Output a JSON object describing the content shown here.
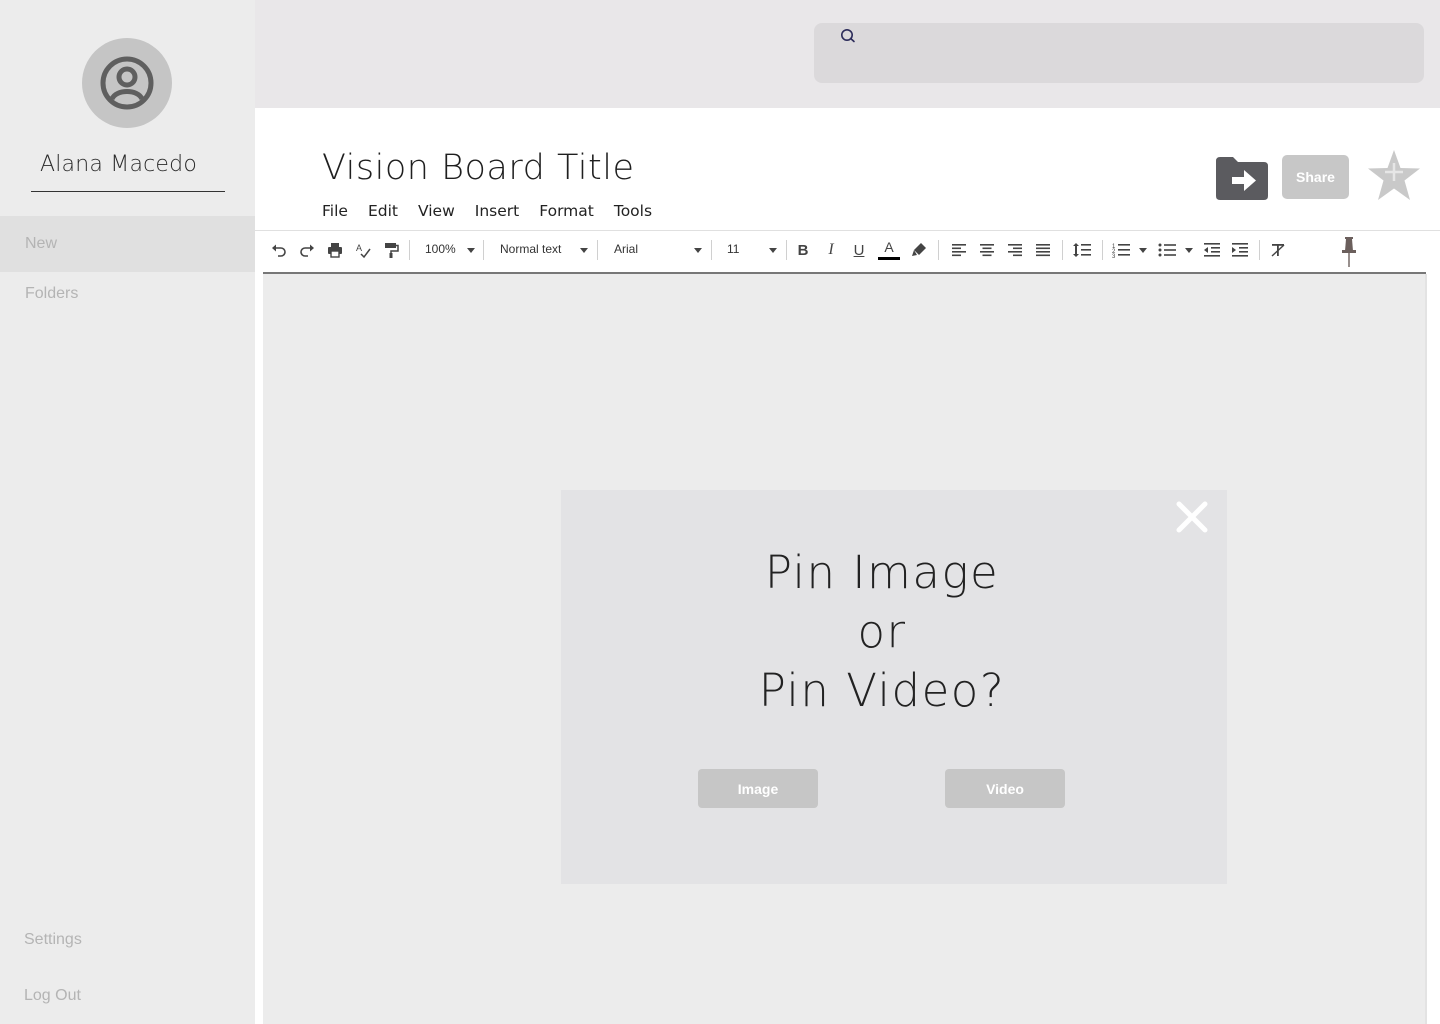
{
  "sidebar": {
    "user_name": "Alana Macedo",
    "avatar_icon": "user-circle-icon",
    "nav": {
      "new": "New",
      "folders": "Folders",
      "settings": "Settings",
      "logout": "Log Out"
    }
  },
  "search": {
    "icon": "search-icon",
    "placeholder": ""
  },
  "document": {
    "title": "Vision Board Title",
    "menu": [
      "File",
      "Edit",
      "View",
      "Insert",
      "Format",
      "Tools"
    ],
    "share_label": "Share",
    "folder_icon": "move-to-folder-icon",
    "star_icon": "star-icon"
  },
  "toolbar": {
    "zoom": "100%",
    "style": "Normal text",
    "font": "Arial",
    "font_size": "11",
    "text_color": "#000000"
  },
  "modal": {
    "line1": "Pin Image",
    "line2": "or",
    "line3": "Pin Video?",
    "image_button": "Image",
    "video_button": "Video"
  },
  "colors": {
    "sidebar_bg": "#ececec",
    "topbar_bg": "#e9e7e9",
    "button_bg": "#c6c6c6",
    "modal_bg": "#e3e3e5",
    "canvas_bg": "#ececec"
  }
}
